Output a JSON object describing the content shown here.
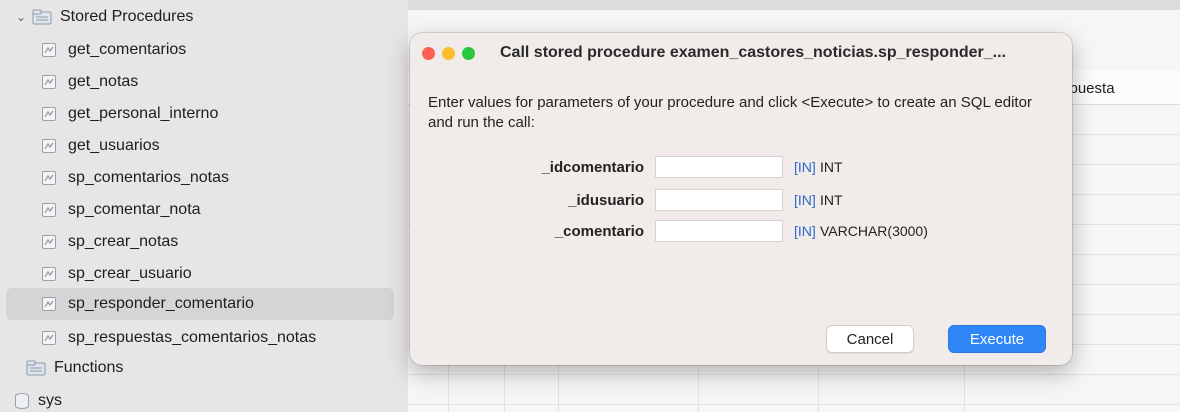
{
  "sidebar": {
    "folder_label": "Stored Procedures",
    "procedures": [
      {
        "label": "get_comentarios"
      },
      {
        "label": "get_notas"
      },
      {
        "label": "get_personal_interno"
      },
      {
        "label": "get_usuarios"
      },
      {
        "label": "sp_comentarios_notas"
      },
      {
        "label": "sp_comentar_nota"
      },
      {
        "label": "sp_crear_notas"
      },
      {
        "label": "sp_crear_usuario"
      },
      {
        "label": "sp_responder_comentario",
        "selected": true
      },
      {
        "label": "sp_respuestas_comentarios_notas"
      }
    ],
    "functions_label": "Functions",
    "schema_label": "sys"
  },
  "background": {
    "column_header": "spuesta"
  },
  "dialog": {
    "title": "Call stored procedure examen_castores_noticias.sp_responder_...",
    "instructions": "Enter values for parameters of your procedure and click <Execute> to create an SQL editor and run the call:",
    "params": [
      {
        "name": "_idcomentario",
        "value": "",
        "mode": "[IN]",
        "type": "INT"
      },
      {
        "name": "_idusuario",
        "value": "",
        "mode": "[IN]",
        "type": "INT"
      },
      {
        "name": "_comentario",
        "value": "",
        "mode": "[IN]",
        "type": "VARCHAR(3000)"
      }
    ],
    "cancel_label": "Cancel",
    "execute_label": "Execute"
  },
  "colors": {
    "accent": "#2f86f6",
    "mode_blue": "#2f67c9",
    "close": "#fe5f57",
    "minimize": "#febc2e",
    "maximize": "#28c840"
  }
}
